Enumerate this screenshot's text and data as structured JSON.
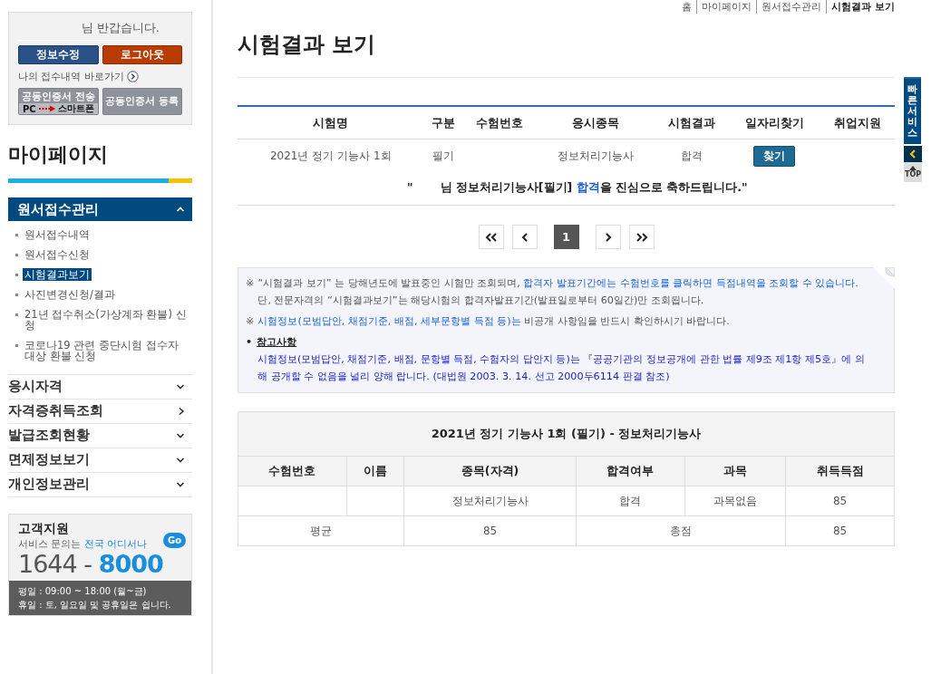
{
  "login_box": {
    "greeting": "님 반갑습니다.",
    "buttons": [
      {
        "label": "정보수정",
        "kind": "primary"
      },
      {
        "label": "로그아웃",
        "kind": "danger"
      }
    ],
    "shortcut": "나의 접수내역 바로가기",
    "cert_send": {
      "label": "공동인증서 전송",
      "from": "PC",
      "to": "스마트폰"
    },
    "cert_register": "공동인증서 등록"
  },
  "sidebar": {
    "title": "마이페이지",
    "sections": [
      {
        "label": "원서접수관리",
        "kind": "toggle",
        "expanded": true,
        "children": [
          {
            "label": "원서접수내역",
            "selected": false
          },
          {
            "label": "원서접수신청",
            "selected": false
          },
          {
            "label": "시험결과보기",
            "selected": true
          },
          {
            "label": "사진변경신청/결과",
            "selected": false
          },
          {
            "label": "21년 접수취소(가상계좌 환불) 신청",
            "selected": false
          },
          {
            "label": "코로나19 관련 중단시험 접수자 대상 환불 신청",
            "selected": false
          }
        ]
      },
      {
        "label": "응시자격",
        "kind": "toggle",
        "expanded": false
      },
      {
        "label": "자격증취득조회",
        "kind": "link",
        "expanded": false
      },
      {
        "label": "발급조회현황",
        "kind": "toggle",
        "expanded": false
      },
      {
        "label": "면제정보보기",
        "kind": "toggle",
        "expanded": false
      },
      {
        "label": "개인정보관리",
        "kind": "toggle",
        "expanded": false
      }
    ]
  },
  "support": {
    "title": "고객지원",
    "line_plain": "서비스 문의는 ",
    "line_highlight": "전국 어디서나",
    "go": "Go",
    "phone_prefix": "1644 - ",
    "phone_number": "8000",
    "hours": [
      "평일 : 09:00 ~ 18:00 (월~금)",
      "휴일 : 토, 일요일 및 공휴일은 쉽니다."
    ]
  },
  "breadcrumb": [
    {
      "label": "홈",
      "selected": false
    },
    {
      "label": "마이페이지",
      "selected": false
    },
    {
      "label": "원서접수관리",
      "selected": false
    },
    {
      "label": "시험결과 보기",
      "selected": true
    }
  ],
  "page_title": "시험결과 보기",
  "results_table": {
    "columns": [
      "시험명",
      "구분",
      "수험번호",
      "응시종목",
      "시험결과",
      "일자리찾기",
      "취업지원"
    ],
    "rows": [
      {
        "exam": "2021년 정기 기능사 1회",
        "type": "필기",
        "number": "",
        "subject": "정보처리기능사",
        "result": "합격",
        "job_button": "찾기"
      }
    ]
  },
  "congrats": {
    "open_quote": "\"",
    "segments": [
      {
        "text": "님 정보처리기능사[필기] ",
        "highlight": false
      },
      {
        "text": "합격",
        "highlight": true
      },
      {
        "text": "을 진심으로 축하드립니다.\"",
        "highlight": false
      }
    ]
  },
  "pagination": [
    {
      "kind": "first",
      "selected": false
    },
    {
      "kind": "prev",
      "selected": false
    },
    {
      "kind": "page",
      "label": "1",
      "selected": true
    },
    {
      "kind": "next",
      "selected": false
    },
    {
      "kind": "last",
      "selected": false
    }
  ],
  "notice": {
    "items": [
      {
        "kind": "mark",
        "mark": "※",
        "segments": [
          {
            "text": "“시험결과 보기” 는 당해년도에 발표중인 시험만 조회되며, ",
            "highlight": false
          },
          {
            "text": "합격자 발표기간에는 수험번호를 클릭하면 득점내역을 조회할 수 있습니다.",
            "highlight": true
          },
          {
            "text": " 단, 전문자격의 “시험결과보기”는 해당시험의 합격자발표기간(발표일로부터 60일간)만 조회됩니다.",
            "highlight": false
          }
        ]
      },
      {
        "kind": "mark",
        "mark": "※",
        "segments": [
          {
            "text": "시험정보(모범답안, 채점기준, 배점, 세부문항별 득점 등)는",
            "highlight": true
          },
          {
            "text": " 비공개 사항임을 반드시 확인하시기 바랍니다.",
            "highlight": false
          }
        ]
      },
      {
        "kind": "bullet",
        "mark": "•",
        "title": "참고사항",
        "segments": [
          {
            "text": "시험정보(모범답안, 채점기준, 배점, 문항별 득점, 수험자의 답안지 등)는 『공공기관의 정보공개에 관한 법률 제9조 제1항 제5호』에 의해 공개할 수 없음을 널리 양해 랍니다. (대법원 2003. 3. 14. 선고 2000두6114 판결 참조)",
            "highlight": true
          }
        ]
      }
    ]
  },
  "score_table": {
    "caption": "2021년 정기 기능사 1회 (필기) - 정보처리기능사",
    "columns": [
      "수험번호",
      "이름",
      "종목(자격)",
      "합격여부",
      "과목",
      "취득득점"
    ],
    "rows": [
      [
        "",
        "",
        "정보처리기능사",
        "합격",
        "과목없음",
        "85"
      ]
    ],
    "summary": {
      "average_label": "평균",
      "average": "85",
      "total_label": "총점",
      "total": "85"
    }
  },
  "quick_service": {
    "label": "빠른서비스",
    "top": "TOP"
  }
}
